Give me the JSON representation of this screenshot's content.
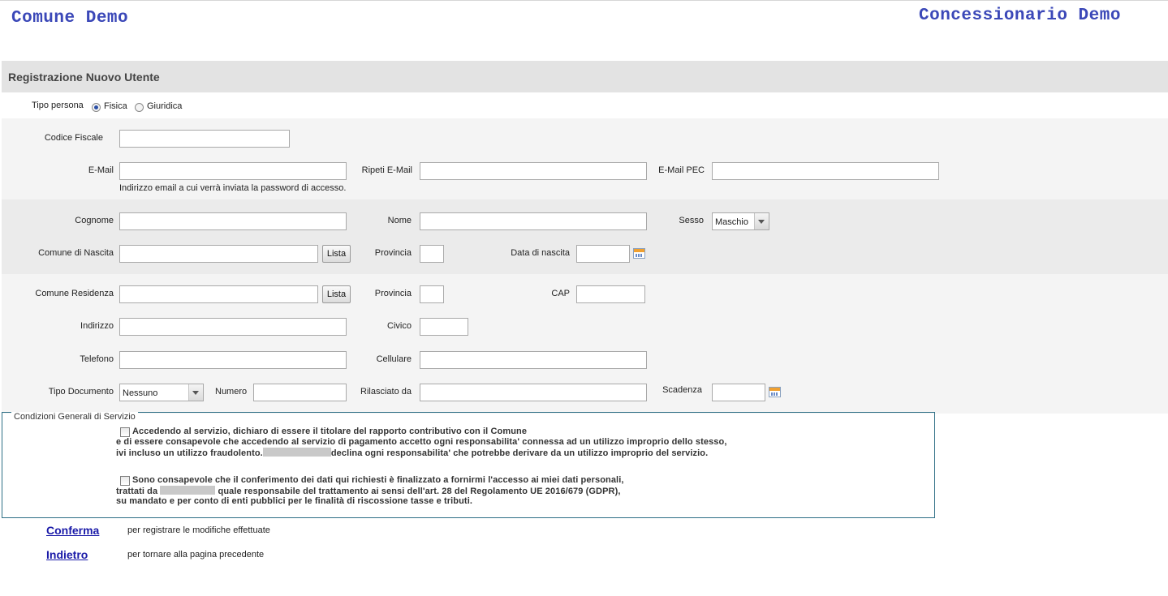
{
  "header": {
    "left_title": "Comune Demo",
    "right_title": "Concessionario Demo"
  },
  "page_title": "Registrazione Nuovo Utente",
  "tipo_persona": {
    "label": "Tipo persona",
    "options": [
      "Fisica",
      "Giuridica"
    ],
    "selected": "Fisica"
  },
  "fields": {
    "codice_fiscale": "Codice Fiscale",
    "email": "E-Mail",
    "email_hint": "Indirizzo email a cui verrà inviata la password di accesso.",
    "ripeti_email": "Ripeti E-Mail",
    "email_pec": "E-Mail PEC",
    "cognome": "Cognome",
    "nome": "Nome",
    "sesso": "Sesso",
    "sesso_value": "Maschio",
    "comune_nascita": "Comune di Nascita",
    "lista": "Lista",
    "provincia": "Provincia",
    "data_nascita": "Data di nascita",
    "comune_residenza": "Comune Residenza",
    "cap": "CAP",
    "indirizzo": "Indirizzo",
    "civico": "Civico",
    "telefono": "Telefono",
    "cellulare": "Cellulare",
    "tipo_documento": "Tipo Documento",
    "tipo_documento_value": "Nessuno",
    "numero": "Numero",
    "rilasciato_da": "Rilasciato da",
    "scadenza": "Scadenza"
  },
  "conditions": {
    "legend": "Condizioni Generali di Servizio",
    "c1_line1": "Accedendo al servizio, dichiaro di essere il titolare del rapporto contributivo con il Comune",
    "c1_line2": "e di essere consapevole che accedendo al servizio di pagamento accetto ogni responsabilita' connessa ad un utilizzo improprio dello stesso,",
    "c1_line3a": "ivi incluso un utilizzo fraudolento.",
    "c1_line3b": "declina ogni responsabilita' che potrebbe derivare da un utilizzo improprio del servizio.",
    "c2_line1": "Sono consapevole che il conferimento dei dati qui richiesti è finalizzato a fornirmi l'accesso ai miei dati personali,",
    "c2_line2a": "trattati da",
    "c2_line2b": "quale responsabile del trattamento ai sensi dell'art. 28 del Regolamento UE 2016/679 (GDPR),",
    "c2_line3": "su mandato e per conto di enti pubblici per le finalità di riscossione tasse e tributi."
  },
  "actions": {
    "confirm_label": "Conferma",
    "confirm_hint": "per registrare le modifiche effettuate",
    "back_label": "Indietro",
    "back_hint": "per tornare alla pagina precedente"
  }
}
